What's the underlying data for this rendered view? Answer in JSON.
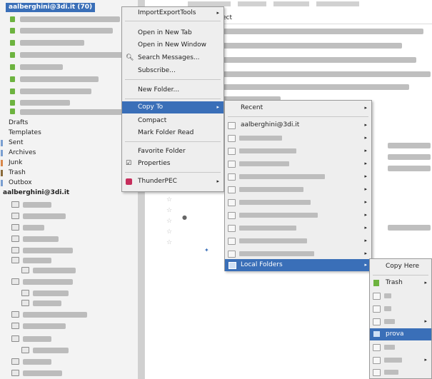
{
  "folder_pane": {
    "account1_label": "aalberghini@3di.it (70)",
    "special_folders": [
      "Drafts",
      "Templates",
      "Sent",
      "Archives",
      "Junk",
      "Trash",
      "Outbox"
    ],
    "account2_label": "aalberghini@3di.it"
  },
  "message_pane": {
    "column_header": "ect"
  },
  "context_menu": {
    "items": [
      {
        "label": "ImportExportTools",
        "submenu": true
      },
      {
        "label": "Open in New Tab"
      },
      {
        "label": "Open in New Window"
      },
      {
        "label": "Search Messages..."
      },
      {
        "label": "Subscribe..."
      },
      {
        "label": "New Folder..."
      },
      {
        "label": "Copy To",
        "submenu": true
      },
      {
        "label": "Compact"
      },
      {
        "label": "Mark Folder Read"
      },
      {
        "label": "Favorite Folder"
      },
      {
        "label": "Properties"
      },
      {
        "label": "ThunderPEC",
        "submenu": true
      }
    ]
  },
  "copy_to_menu": {
    "recent_label": "Recent",
    "account_label": "aalberghini@3di.it",
    "local_folders_label": "Local Folders"
  },
  "local_folders_menu": {
    "copy_here_label": "Copy Here",
    "trash_label": "Trash",
    "prova_label": "prova"
  },
  "colors": {
    "highlight": "#3a6fb8",
    "menu_bg": "#eeeeee",
    "folder_green": "#6db33f"
  }
}
